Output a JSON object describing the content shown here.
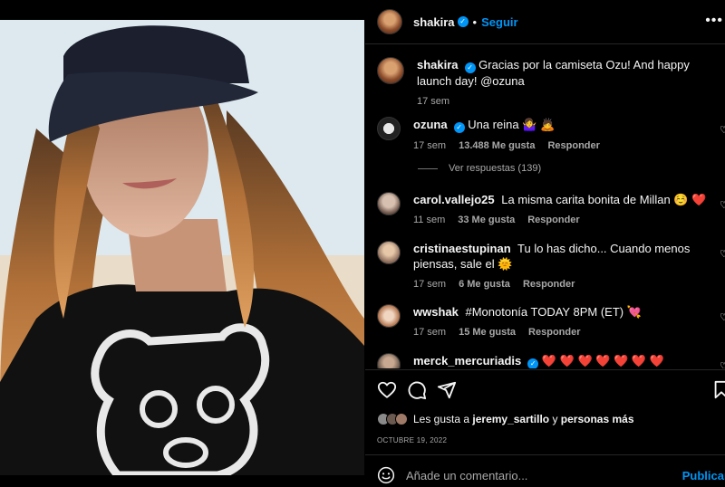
{
  "header": {
    "username": "shakira",
    "separator": "•",
    "follow_label": "Seguir",
    "more_label": "•••"
  },
  "caption": {
    "username": "shakira",
    "text": "Gracias por la camiseta Ozu! And happy launch day! @ozuna",
    "time": "17 sem"
  },
  "comments": [
    {
      "username": "ozuna",
      "verified": true,
      "text": "Una reina 🤷‍♀️ 🙇",
      "time": "17 sem",
      "likes": "13.488 Me gusta",
      "reply": "Responder"
    },
    {
      "username": "carol.vallejo25",
      "verified": false,
      "text": "La misma carita bonita de Millan ☺️ ❤️",
      "time": "11 sem",
      "likes": "33 Me gusta",
      "reply": "Responder"
    },
    {
      "username": "cristinaestupinan",
      "verified": false,
      "text": "Tu lo has dicho... Cuando menos piensas, sale el 🌞",
      "time": "17 sem",
      "likes": "6 Me gusta",
      "reply": "Responder"
    },
    {
      "username": "wwshak",
      "verified": false,
      "text": "#Monotonía TODAY 8PM (ET) 💘",
      "time": "17 sem",
      "likes": "15 Me gusta",
      "reply": "Responder"
    },
    {
      "username": "merck_mercuriadis",
      "verified": true,
      "text": "❤️ ❤️ ❤️ ❤️ ❤️ ❤️ ❤️",
      "time": "",
      "likes": "",
      "reply": ""
    }
  ],
  "view_replies": "Ver respuestas (139)",
  "likes_line": {
    "prefix": "Les gusta a",
    "user": "jeremy_sartillo",
    "mid": "y",
    "suffix": "personas más"
  },
  "date": "OCTUBRE 19, 2022",
  "add_comment": {
    "placeholder": "Añade un comentario...",
    "publish_label": "Publicar"
  },
  "icons": [
    "verified-icon",
    "more-icon",
    "heart-icon",
    "comment-icon",
    "share-icon",
    "bookmark-icon",
    "emoji-icon"
  ],
  "colors": {
    "accent": "#0095f6",
    "background": "#000000",
    "muted": "#a8a8a8"
  }
}
